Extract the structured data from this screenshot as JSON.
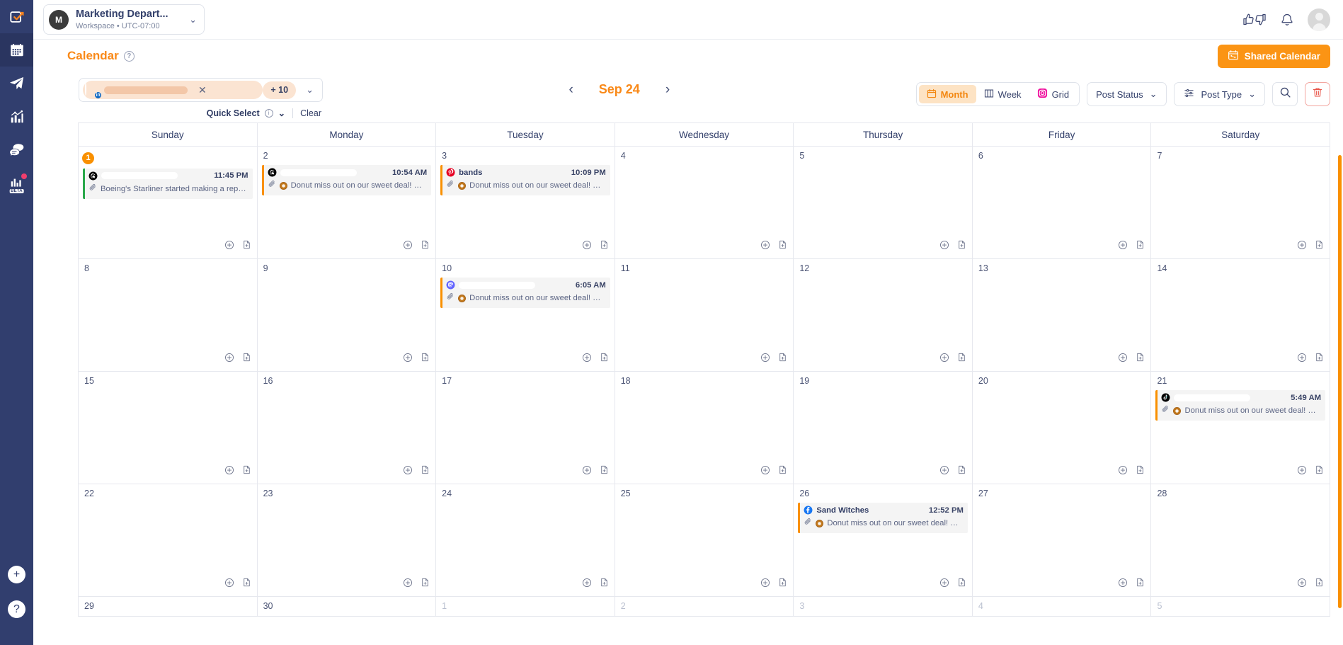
{
  "sidebar": {
    "items": [
      {
        "name": "compose",
        "icon": "compose-icon",
        "active": false
      },
      {
        "name": "calendar",
        "icon": "calendar-icon",
        "active": true
      },
      {
        "name": "publish",
        "icon": "paper-plane-icon",
        "active": false
      },
      {
        "name": "analytics",
        "icon": "analytics-chart-icon",
        "active": false
      },
      {
        "name": "engage",
        "icon": "chat-bubbles-icon",
        "active": false
      },
      {
        "name": "beta-reports",
        "icon": "bar-chart-beta-icon",
        "active": false,
        "badge": "BETA",
        "dot": true
      }
    ],
    "bottom": [
      {
        "name": "add",
        "label": "+"
      },
      {
        "name": "help",
        "label": "?"
      }
    ]
  },
  "topbar": {
    "workspace_initial": "M",
    "workspace_name": "Marketing Depart...",
    "workspace_sub": "Workspace • UTC-07:00",
    "chevron": "⌄",
    "icons": [
      "thumbs-up-down-icon",
      "bell-icon",
      "user-avatar"
    ]
  },
  "header": {
    "title": "Calendar",
    "help": "?",
    "shared_calendar_label": "Shared Calendar"
  },
  "toolbar": {
    "account_chip": {
      "avatar_badge": "in",
      "name_redacted": "",
      "remove": "✕",
      "more_count": "+ 10",
      "chevron": "⌄"
    },
    "quick_select_label": "Quick Select",
    "quick_select_info": "i",
    "quick_select_chevron": "⌄",
    "clear_label": "Clear",
    "date_prev": "‹",
    "date_label": "Sep 24",
    "date_next": "›",
    "views": [
      {
        "label": "Month",
        "icon": "calendar-icon",
        "active": true
      },
      {
        "label": "Week",
        "icon": "columns-icon",
        "active": false
      },
      {
        "label": "Grid",
        "icon": "instagram-icon",
        "active": false
      }
    ],
    "post_status_label": "Post Status",
    "post_status_chevron": "⌄",
    "post_type_label": "Post Type",
    "post_type_chevron": "⌄",
    "search_icon": "search-icon",
    "delete_icon": "trash-icon"
  },
  "calendar": {
    "weekdays": [
      "Sunday",
      "Monday",
      "Tuesday",
      "Wednesday",
      "Thursday",
      "Friday",
      "Saturday"
    ],
    "weeks": [
      [
        {
          "day": "1",
          "today": true,
          "events": [
            {
              "network": "threads",
              "account": "",
              "redacted": true,
              "time": "11:45 PM",
              "text": "Boeing's Starliner started making a repeati...",
              "bar": "#2aa84a",
              "attachment": true,
              "donut": false
            }
          ]
        },
        {
          "day": "2",
          "events": [
            {
              "network": "threads",
              "account": "",
              "redacted": true,
              "time": "10:54 AM",
              "text": "Donut miss out on our sweet deal! Get...",
              "bar": "#f99000",
              "attachment": true,
              "donut": true
            }
          ]
        },
        {
          "day": "3",
          "events": [
            {
              "network": "pinterest",
              "account": "bands",
              "redacted": false,
              "time": "10:09 PM",
              "text": "Donut miss out on our sweet deal! Get...",
              "bar": "#f99000",
              "attachment": true,
              "donut": true
            }
          ]
        },
        {
          "day": "4",
          "events": []
        },
        {
          "day": "5",
          "events": []
        },
        {
          "day": "6",
          "events": []
        },
        {
          "day": "7",
          "events": []
        }
      ],
      [
        {
          "day": "8",
          "events": []
        },
        {
          "day": "9",
          "events": []
        },
        {
          "day": "10",
          "events": [
            {
              "network": "mastodon",
              "account": "",
              "redacted": true,
              "time": "6:05 AM",
              "text": "Donut miss out on our sweet deal! Get...",
              "bar": "#f99000",
              "attachment": true,
              "donut": true
            }
          ]
        },
        {
          "day": "11",
          "events": []
        },
        {
          "day": "12",
          "events": []
        },
        {
          "day": "13",
          "events": []
        },
        {
          "day": "14",
          "events": []
        }
      ],
      [
        {
          "day": "15",
          "events": []
        },
        {
          "day": "16",
          "events": []
        },
        {
          "day": "17",
          "events": []
        },
        {
          "day": "18",
          "events": []
        },
        {
          "day": "19",
          "events": []
        },
        {
          "day": "20",
          "events": []
        },
        {
          "day": "21",
          "events": [
            {
              "network": "tiktok",
              "account": "",
              "redacted": true,
              "time": "5:49 AM",
              "text": "Donut miss out on our sweet deal! Get...",
              "bar": "#f99000",
              "attachment": true,
              "donut": true
            }
          ]
        }
      ],
      [
        {
          "day": "22",
          "events": []
        },
        {
          "day": "23",
          "events": []
        },
        {
          "day": "24",
          "events": []
        },
        {
          "day": "25",
          "events": []
        },
        {
          "day": "26",
          "events": [
            {
              "network": "facebook",
              "account": "Sand Witches",
              "redacted": false,
              "time": "12:52 PM",
              "text": "Donut miss out on our sweet deal! Get...",
              "bar": "#f99000",
              "attachment": true,
              "donut": true
            }
          ]
        },
        {
          "day": "27",
          "events": []
        },
        {
          "day": "28",
          "events": []
        }
      ],
      [
        {
          "day": "29",
          "muted": false,
          "events": []
        },
        {
          "day": "30",
          "muted": false,
          "events": []
        },
        {
          "day": "1",
          "muted": true,
          "events": []
        },
        {
          "day": "2",
          "muted": true,
          "events": []
        },
        {
          "day": "3",
          "muted": true,
          "events": []
        },
        {
          "day": "4",
          "muted": true,
          "events": []
        },
        {
          "day": "5",
          "muted": true,
          "events": []
        }
      ]
    ],
    "cell_add_icon": "plus-circle-icon",
    "cell_doc_icon": "document-plus-icon"
  },
  "colors": {
    "accent": "#f98918",
    "sidebar": "#313e6e",
    "today": "#f99000",
    "green_bar": "#2aa84a",
    "orange_bar": "#f99000",
    "danger": "#e8564a"
  }
}
